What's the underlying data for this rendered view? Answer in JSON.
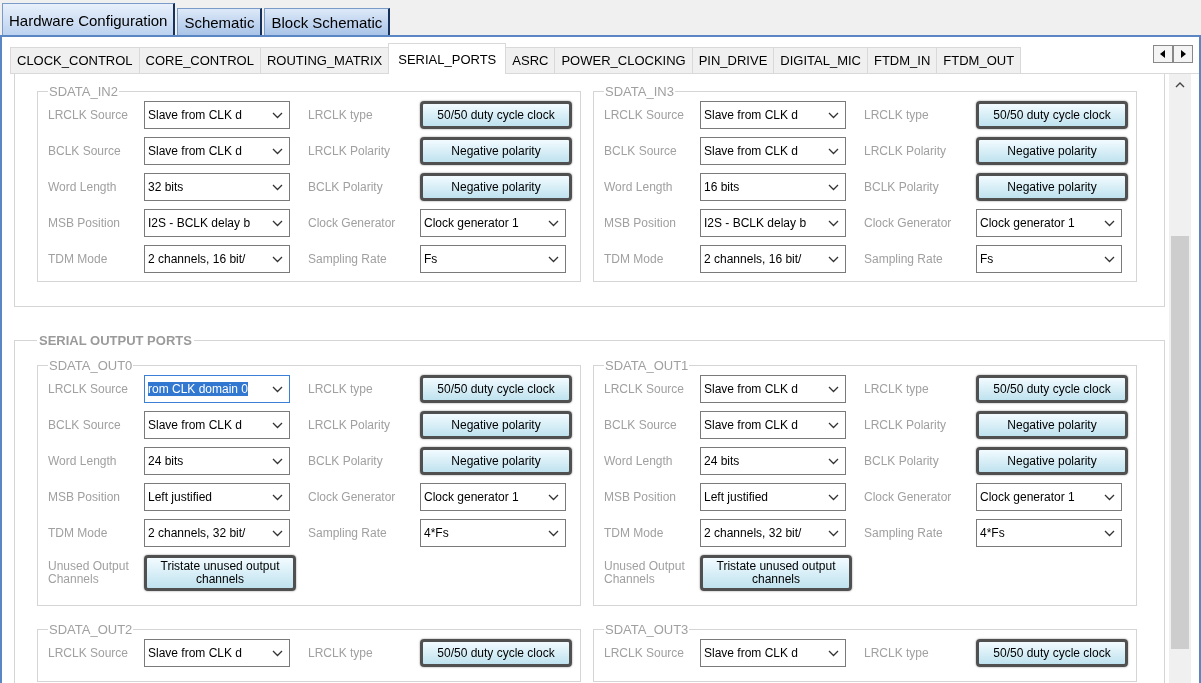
{
  "tabs": [
    {
      "label": "Hardware Configuration",
      "selected": true
    },
    {
      "label": "Schematic",
      "selected": false
    },
    {
      "label": "Block Schematic",
      "selected": false
    }
  ],
  "subtabs": [
    {
      "label": "CLOCK_CONTROL",
      "selected": false
    },
    {
      "label": "CORE_CONTROL",
      "selected": false
    },
    {
      "label": "ROUTING_MATRIX",
      "selected": false
    },
    {
      "label": "SERIAL_PORTS",
      "selected": true
    },
    {
      "label": "ASRC",
      "selected": false
    },
    {
      "label": "POWER_CLOCKING",
      "selected": false
    },
    {
      "label": "PIN_DRIVE",
      "selected": false
    },
    {
      "label": "DIGITAL_MIC",
      "selected": false
    },
    {
      "label": "FTDM_IN",
      "selected": false
    },
    {
      "label": "FTDM_OUT",
      "selected": false
    }
  ],
  "input_ports": {
    "groups": [
      {
        "title": "SDATA_IN2",
        "fields": [
          {
            "label": "LRCLK Source",
            "kind": "combo",
            "value": "Slave from CLK d",
            "focused": false
          },
          {
            "label": "LRCLK type",
            "kind": "toggle",
            "value": "50/50 duty cycle clock"
          },
          {
            "label": "BCLK Source",
            "kind": "combo",
            "value": "Slave from CLK d",
            "focused": false
          },
          {
            "label": "LRCLK Polarity",
            "kind": "toggle",
            "value": "Negative polarity"
          },
          {
            "label": "Word Length",
            "kind": "combo",
            "value": "32 bits",
            "focused": false
          },
          {
            "label": "BCLK Polarity",
            "kind": "toggle",
            "value": "Negative polarity"
          },
          {
            "label": "MSB Position",
            "kind": "combo",
            "value": "I2S - BCLK delay b",
            "focused": false
          },
          {
            "label": "Clock Generator",
            "kind": "combo",
            "value": "Clock generator 1",
            "focused": false
          },
          {
            "label": "TDM Mode",
            "kind": "combo",
            "value": "2 channels, 16 bit/",
            "focused": false
          },
          {
            "label": "Sampling Rate",
            "kind": "combo",
            "value": "Fs",
            "focused": false
          }
        ]
      },
      {
        "title": "SDATA_IN3",
        "fields": [
          {
            "label": "LRCLK Source",
            "kind": "combo",
            "value": "Slave from CLK d",
            "focused": false
          },
          {
            "label": "LRCLK type",
            "kind": "toggle",
            "value": "50/50 duty cycle clock"
          },
          {
            "label": "BCLK Source",
            "kind": "combo",
            "value": "Slave from CLK d",
            "focused": false
          },
          {
            "label": "LRCLK Polarity",
            "kind": "toggle",
            "value": "Negative polarity"
          },
          {
            "label": "Word Length",
            "kind": "combo",
            "value": "16 bits",
            "focused": false
          },
          {
            "label": "BCLK Polarity",
            "kind": "toggle",
            "value": "Negative polarity"
          },
          {
            "label": "MSB Position",
            "kind": "combo",
            "value": "I2S - BCLK delay b",
            "focused": false
          },
          {
            "label": "Clock Generator",
            "kind": "combo",
            "value": "Clock generator 1",
            "focused": false
          },
          {
            "label": "TDM Mode",
            "kind": "combo",
            "value": "2 channels, 16 bit/",
            "focused": false
          },
          {
            "label": "Sampling Rate",
            "kind": "combo",
            "value": "Fs",
            "focused": false
          }
        ]
      }
    ]
  },
  "output_ports": {
    "title": "SERIAL OUTPUT PORTS",
    "groups": [
      {
        "title": "SDATA_OUT0",
        "fields": [
          {
            "label": "LRCLK Source",
            "kind": "combo",
            "value": "rom CLK domain 0",
            "focused": true
          },
          {
            "label": "LRCLK type",
            "kind": "toggle",
            "value": "50/50 duty cycle clock"
          },
          {
            "label": "BCLK Source",
            "kind": "combo",
            "value": "Slave from CLK d",
            "focused": false
          },
          {
            "label": "LRCLK Polarity",
            "kind": "toggle",
            "value": "Negative polarity"
          },
          {
            "label": "Word Length",
            "kind": "combo",
            "value": "24 bits",
            "focused": false
          },
          {
            "label": "BCLK Polarity",
            "kind": "toggle",
            "value": "Negative polarity"
          },
          {
            "label": "MSB Position",
            "kind": "combo",
            "value": "Left justified",
            "focused": false
          },
          {
            "label": "Clock Generator",
            "kind": "combo",
            "value": "Clock generator 1",
            "focused": false
          },
          {
            "label": "TDM Mode",
            "kind": "combo",
            "value": "2 channels, 32 bit/",
            "focused": false
          },
          {
            "label": "Sampling Rate",
            "kind": "combo",
            "value": "4*Fs",
            "focused": false
          },
          {
            "label": "Unused Output Channels",
            "kind": "toggle",
            "value": "Tristate unused output channels"
          }
        ]
      },
      {
        "title": "SDATA_OUT1",
        "fields": [
          {
            "label": "LRCLK Source",
            "kind": "combo",
            "value": "Slave from CLK d",
            "focused": false
          },
          {
            "label": "LRCLK type",
            "kind": "toggle",
            "value": "50/50 duty cycle clock"
          },
          {
            "label": "BCLK Source",
            "kind": "combo",
            "value": "Slave from CLK d",
            "focused": false
          },
          {
            "label": "LRCLK Polarity",
            "kind": "toggle",
            "value": "Negative polarity"
          },
          {
            "label": "Word Length",
            "kind": "combo",
            "value": "24 bits",
            "focused": false
          },
          {
            "label": "BCLK Polarity",
            "kind": "toggle",
            "value": "Negative polarity"
          },
          {
            "label": "MSB Position",
            "kind": "combo",
            "value": "Left justified",
            "focused": false
          },
          {
            "label": "Clock Generator",
            "kind": "combo",
            "value": "Clock generator 1",
            "focused": false
          },
          {
            "label": "TDM Mode",
            "kind": "combo",
            "value": "2 channels, 32 bit/",
            "focused": false
          },
          {
            "label": "Sampling Rate",
            "kind": "combo",
            "value": "4*Fs",
            "focused": false
          },
          {
            "label": "Unused Output Channels",
            "kind": "toggle",
            "value": "Tristate unused output channels"
          }
        ]
      },
      {
        "title": "SDATA_OUT2",
        "fields": [
          {
            "label": "LRCLK Source",
            "kind": "combo",
            "value": "Slave from CLK d",
            "focused": false
          },
          {
            "label": "LRCLK type",
            "kind": "toggle",
            "value": "50/50 duty cycle clock"
          }
        ]
      },
      {
        "title": "SDATA_OUT3",
        "fields": [
          {
            "label": "LRCLK Source",
            "kind": "combo",
            "value": "Slave from CLK d",
            "focused": false
          },
          {
            "label": "LRCLK type",
            "kind": "toggle",
            "value": "50/50 duty cycle clock"
          }
        ]
      }
    ]
  }
}
